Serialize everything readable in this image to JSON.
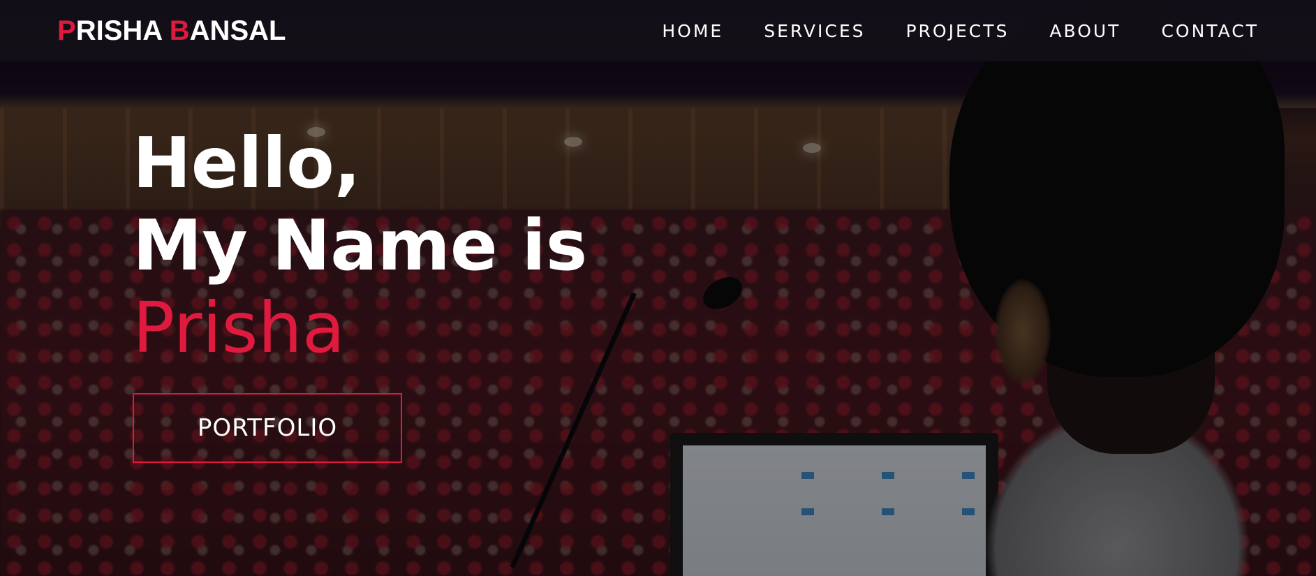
{
  "navbar": {
    "logo": {
      "first_initial": "P",
      "first_rest": "RISHA",
      "last_initial": "B",
      "last_rest": "ANSAL"
    },
    "links": [
      {
        "label": "HOME"
      },
      {
        "label": "SERVICES"
      },
      {
        "label": "PROJECTS"
      },
      {
        "label": "ABOUT"
      },
      {
        "label": "CONTACT"
      }
    ]
  },
  "hero": {
    "line1": "Hello,",
    "line2": "My Name is",
    "name": "Prisha",
    "button_label": "PORTFOLIO"
  },
  "colors": {
    "accent": "#e0193f",
    "text": "#ffffff",
    "navbar_bg": "#141018"
  }
}
